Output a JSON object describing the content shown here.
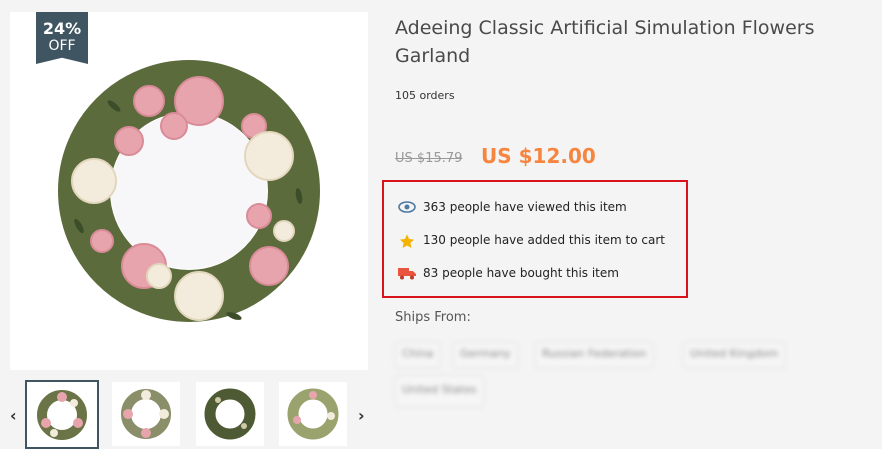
{
  "product": {
    "discount_pct": "24%",
    "discount_off": "OFF",
    "title": "Adeeing Classic Artificial Simulation Flowers Garland",
    "orders": "105 orders",
    "old_price": "US $15.79",
    "new_price": "US $12.00"
  },
  "stats": {
    "viewed": "363 people have viewed this item",
    "cart": "130 people have added this item to cart",
    "bought": "83 people have bought this item"
  },
  "shipping": {
    "label": "Ships From:",
    "options": [
      "China",
      "Germany",
      "Russian Federation",
      "United Kingdom",
      "United States"
    ]
  },
  "gallery": {
    "prev_arrow": "‹",
    "next_arrow": "›",
    "thumbnails": [
      "wreath-pink-roses",
      "wreath-white-roses",
      "wreath-greenery",
      "wreath-green-pink"
    ]
  },
  "colors": {
    "accent_price": "#f5853f",
    "badge_bg": "#3f5561",
    "highlight_border": "#d9121c"
  }
}
